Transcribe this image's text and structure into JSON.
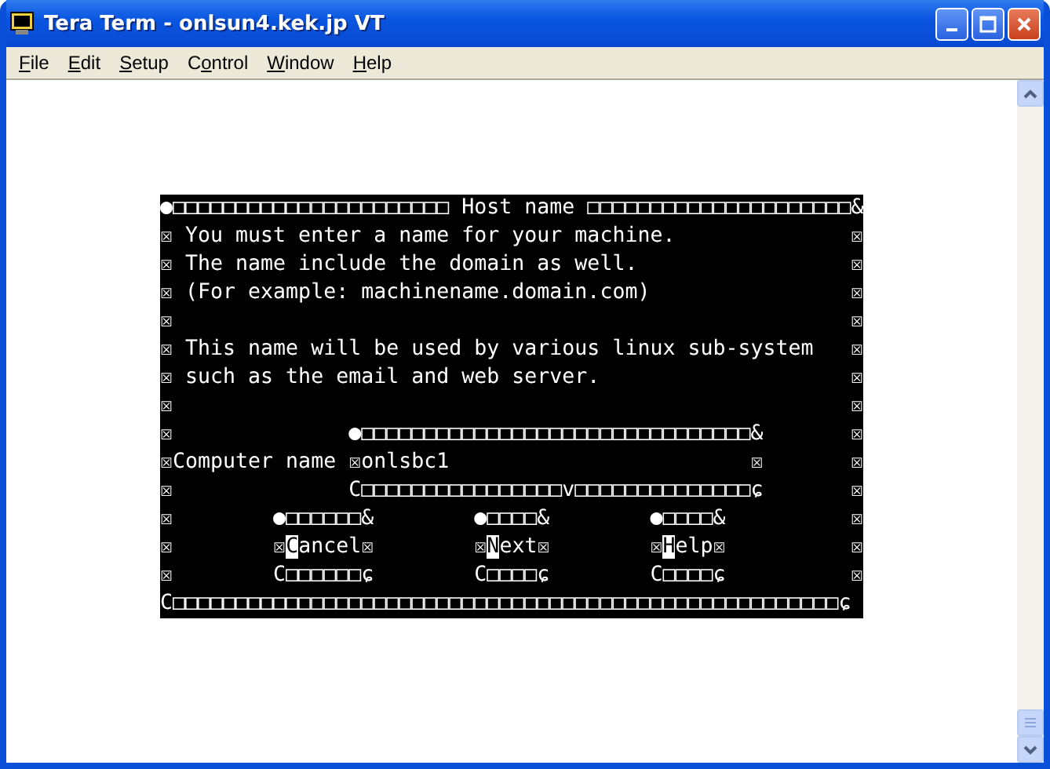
{
  "window": {
    "title": "Tera Term - onlsun4.kek.jp VT"
  },
  "menu": [
    {
      "key": "F",
      "rest": "ile"
    },
    {
      "key": "E",
      "rest": "dit"
    },
    {
      "key": "S",
      "rest": "etup"
    },
    {
      "lead": "C",
      "key": "o",
      "rest": "ntrol"
    },
    {
      "key": "W",
      "rest": "indow"
    },
    {
      "key": "H",
      "rest": "elp"
    }
  ],
  "terminal": {
    "lines": [
      {
        "segments": [
          {
            "text": "●□□□□□□□□□□□□□□□□□□□□□□ Host name □□□□□□□□□□□□□□□□□□□□□&",
            "reverse": false
          }
        ]
      },
      {
        "segments": [
          {
            "text": "☒ You must enter a name for your machine.",
            "reverse": false
          }
        ],
        "edge": "☒"
      },
      {
        "segments": [
          {
            "text": "☒ The name include the domain as well.",
            "reverse": false
          }
        ],
        "edge": "☒"
      },
      {
        "segments": [
          {
            "text": "☒ (For example: machinename.domain.com)",
            "reverse": false
          }
        ],
        "edge": "☒"
      },
      {
        "segments": [
          {
            "text": "☒",
            "reverse": false
          }
        ],
        "edge": "☒"
      },
      {
        "segments": [
          {
            "text": "☒ This name will be used by various linux sub-system",
            "reverse": false
          }
        ],
        "edge": "☒"
      },
      {
        "segments": [
          {
            "text": "☒ such as the email and web server.",
            "reverse": false
          }
        ],
        "edge": "☒"
      },
      {
        "segments": [
          {
            "text": "☒",
            "reverse": false
          }
        ],
        "edge": "☒"
      },
      {
        "segments": [
          {
            "text": "☒              ●□□□□□□□□□□□□□□□□□□□□□□□□□□□□□□□&",
            "reverse": false
          }
        ],
        "edge": "☒"
      },
      {
        "segments": [
          {
            "text": "☒Computer name ☒onlsbc1                        ☒",
            "reverse": false
          }
        ],
        "edge": "☒"
      },
      {
        "segments": [
          {
            "text": "☒              C□□□□□□□□□□□□□□□□v□□□□□□□□□□□□□□ɕ",
            "reverse": false
          }
        ],
        "edge": "☒"
      },
      {
        "segments": [
          {
            "text": "☒        ●□□□□□□&        ●□□□□&        ●□□□□&",
            "reverse": false
          }
        ],
        "edge": "☒"
      },
      {
        "segments": [
          {
            "text": "☒        ☒",
            "reverse": false
          },
          {
            "text": "C",
            "reverse": true
          },
          {
            "text": "ancel☒        ☒",
            "reverse": false
          },
          {
            "text": "N",
            "reverse": true
          },
          {
            "text": "ext☒        ☒",
            "reverse": false
          },
          {
            "text": "H",
            "reverse": true
          },
          {
            "text": "elp☒",
            "reverse": false
          }
        ],
        "edge": "☒"
      },
      {
        "segments": [
          {
            "text": "☒        C□□□□□□ɕ        C□□□□ɕ        C□□□□ɕ",
            "reverse": false
          }
        ],
        "edge": "☒"
      },
      {
        "segments": [
          {
            "text": "C□□□□□□□□□□□□□□□□□□□□□□□□□□□□□□□□□□□□□□□□□□□□□□□□□□□□□ɕ",
            "reverse": false
          }
        ]
      }
    ]
  }
}
